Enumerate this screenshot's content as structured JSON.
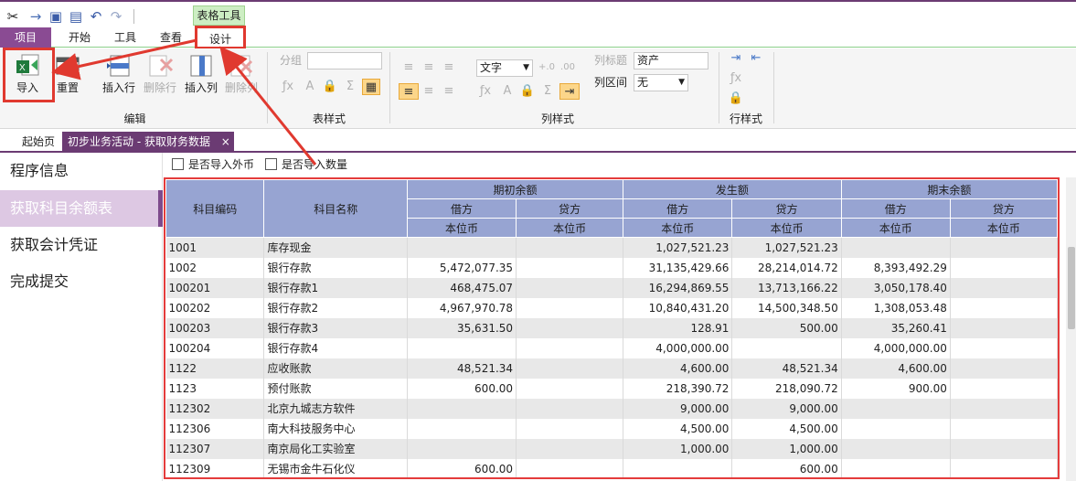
{
  "ribbon_context_tab": "表格工具",
  "tabs": [
    "项目",
    "开始",
    "工具",
    "查看",
    "设计"
  ],
  "groups": {
    "edit": {
      "label": "编辑",
      "buttons": {
        "import": "导入",
        "reset": "重置",
        "insert_row": "插入行",
        "delete_row": "删除行",
        "insert_col": "插入列",
        "delete_col": "删除列"
      }
    },
    "table_style": {
      "label": "表样式",
      "group_field_label": "分组",
      "group_field_value": ""
    },
    "col_style": {
      "label": "列样式",
      "type_value": "文字",
      "col_title_label": "列标题",
      "col_title_value": "资产",
      "col_interval_label": "列区间",
      "col_interval_value": "无"
    },
    "row_style": {
      "label": "行样式"
    }
  },
  "doc_tabs": {
    "start": "起始页",
    "active": "初步业务活动 - 获取财务数据",
    "close": "×"
  },
  "nav": [
    {
      "label": "程序信息",
      "active": false
    },
    {
      "label": "获取科目余额表",
      "active": true
    },
    {
      "label": "获取会计凭证",
      "active": false
    },
    {
      "label": "完成提交",
      "active": false
    }
  ],
  "options": {
    "import_foreign": "是否导入外币",
    "import_quantity": "是否导入数量"
  },
  "table": {
    "header": {
      "code": "科目编码",
      "name": "科目名称",
      "opening": "期初余额",
      "occurrence": "发生额",
      "closing": "期末余额",
      "debit": "借方",
      "credit": "贷方",
      "currency": "本位币"
    },
    "rows": [
      {
        "code": "1001",
        "name": "库存现金",
        "od": "",
        "oc": "",
        "md": "1,027,521.23",
        "mc": "1,027,521.23",
        "cd": "",
        "cc": ""
      },
      {
        "code": "1002",
        "name": "银行存款",
        "od": "5,472,077.35",
        "oc": "",
        "md": "31,135,429.66",
        "mc": "28,214,014.72",
        "cd": "8,393,492.29",
        "cc": ""
      },
      {
        "code": "100201",
        "name": "银行存款1",
        "od": "468,475.07",
        "oc": "",
        "md": "16,294,869.55",
        "mc": "13,713,166.22",
        "cd": "3,050,178.40",
        "cc": ""
      },
      {
        "code": "100202",
        "name": "银行存款2",
        "od": "4,967,970.78",
        "oc": "",
        "md": "10,840,431.20",
        "mc": "14,500,348.50",
        "cd": "1,308,053.48",
        "cc": ""
      },
      {
        "code": "100203",
        "name": "银行存款3",
        "od": "35,631.50",
        "oc": "",
        "md": "128.91",
        "mc": "500.00",
        "cd": "35,260.41",
        "cc": ""
      },
      {
        "code": "100204",
        "name": "银行存款4",
        "od": "",
        "oc": "",
        "md": "4,000,000.00",
        "mc": "",
        "cd": "4,000,000.00",
        "cc": ""
      },
      {
        "code": "1122",
        "name": "应收账款",
        "od": "48,521.34",
        "oc": "",
        "md": "4,600.00",
        "mc": "48,521.34",
        "cd": "4,600.00",
        "cc": ""
      },
      {
        "code": "1123",
        "name": "预付账款",
        "od": "600.00",
        "oc": "",
        "md": "218,390.72",
        "mc": "218,090.72",
        "cd": "900.00",
        "cc": ""
      },
      {
        "code": "112302",
        "name": "北京九城志方软件",
        "od": "",
        "oc": "",
        "md": "9,000.00",
        "mc": "9,000.00",
        "cd": "",
        "cc": ""
      },
      {
        "code": "112306",
        "name": "南大科技服务中心",
        "od": "",
        "oc": "",
        "md": "4,500.00",
        "mc": "4,500.00",
        "cd": "",
        "cc": ""
      },
      {
        "code": "112307",
        "name": "南京局化工实验室",
        "od": "",
        "oc": "",
        "md": "1,000.00",
        "mc": "1,000.00",
        "cd": "",
        "cc": ""
      },
      {
        "code": "112309",
        "name": "无锡市金牛石化仪",
        "od": "600.00",
        "oc": "",
        "md": "",
        "mc": "600.00",
        "cd": "",
        "cc": ""
      }
    ]
  },
  "colors": {
    "accent": "#6b3b73",
    "header_bg": "#97a4d2",
    "highlight": "#e0392f"
  }
}
